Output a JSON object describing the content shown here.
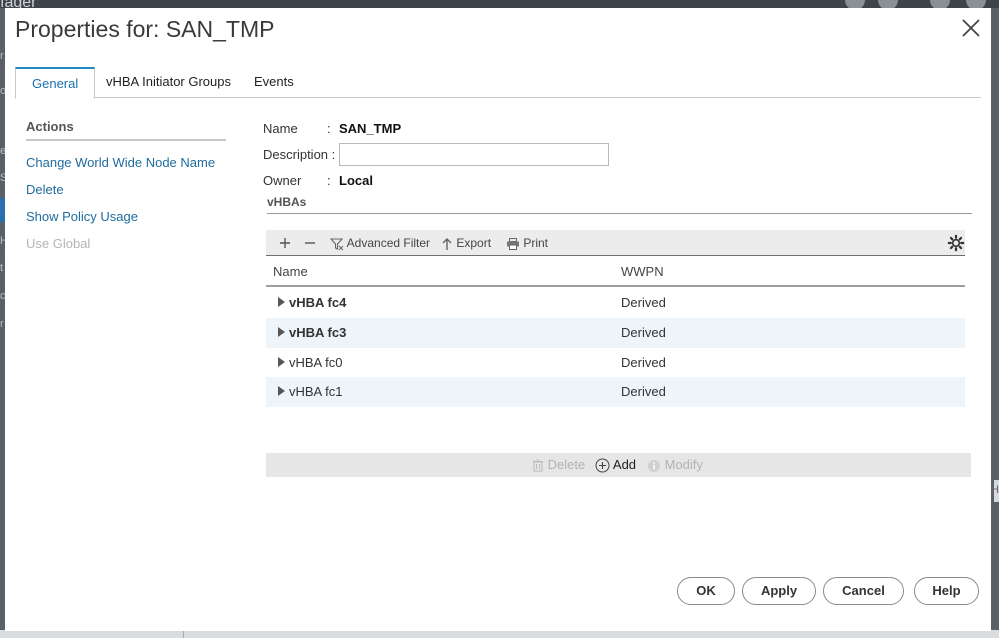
{
  "background": {
    "app_title": "ıager",
    "left_chars": [
      "r",
      "of",
      "e",
      "S",
      "A",
      "H",
      "t",
      "c",
      "r"
    ],
    "right_char": "H"
  },
  "dialog": {
    "title": "Properties for: SAN_TMP",
    "tabs": [
      {
        "label": "General",
        "active": true
      },
      {
        "label": "vHBA Initiator Groups",
        "active": false
      },
      {
        "label": "Events",
        "active": false
      }
    ]
  },
  "actions": {
    "title": "Actions",
    "items": [
      {
        "label": "Change World Wide Node Name",
        "enabled": true
      },
      {
        "label": "Delete",
        "enabled": true
      },
      {
        "label": "Show Policy Usage",
        "enabled": true
      },
      {
        "label": "Use Global",
        "enabled": false
      }
    ]
  },
  "properties": {
    "name_label": "Name",
    "name_colon": ":",
    "name_value": "SAN_TMP",
    "description_label": "Description :",
    "description_value": "",
    "owner_label": "Owner",
    "owner_colon": ":",
    "owner_value": "Local"
  },
  "vhbas": {
    "section_title": "vHBAs",
    "toolbar": {
      "add_icon": "plus-icon",
      "remove_icon": "minus-icon",
      "advanced_filter": "Advanced Filter",
      "export": "Export",
      "print": "Print",
      "settings_icon": "gear-icon"
    },
    "columns": [
      "Name",
      "WWPN"
    ],
    "rows": [
      {
        "name": "vHBA fc4",
        "wwpn": "Derived",
        "bold": true
      },
      {
        "name": "vHBA fc3",
        "wwpn": "Derived",
        "bold": true
      },
      {
        "name": "vHBA fc0",
        "wwpn": "Derived",
        "bold": false
      },
      {
        "name": "vHBA fc1",
        "wwpn": "Derived",
        "bold": false
      }
    ],
    "bottom_actions": {
      "delete": "Delete",
      "add": "Add",
      "modify": "Modify"
    }
  },
  "buttons": {
    "ok": "OK",
    "apply": "Apply",
    "cancel": "Cancel",
    "help": "Help"
  },
  "colors": {
    "accent": "#1e8bc3",
    "link": "#1f6c9e",
    "row_alt": "#eef5fa"
  }
}
